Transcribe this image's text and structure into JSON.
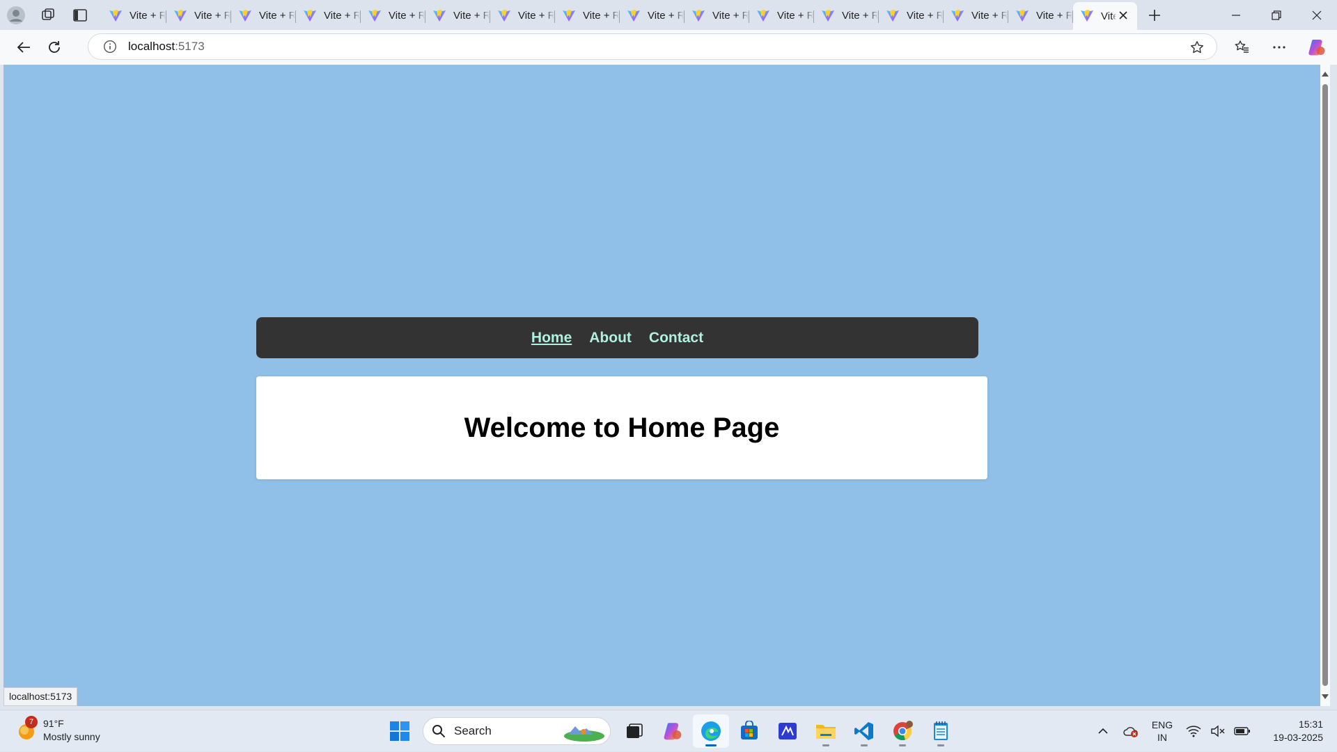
{
  "browser": {
    "tabs": [
      {
        "title": "Vite + React"
      },
      {
        "title": "Vite + React"
      },
      {
        "title": "Vite + React"
      },
      {
        "title": "Vite + React"
      },
      {
        "title": "Vite + React"
      },
      {
        "title": "Vite + React"
      },
      {
        "title": "Vite + React"
      },
      {
        "title": "Vite + React"
      },
      {
        "title": "Vite + React"
      },
      {
        "title": "Vite + React"
      },
      {
        "title": "Vite + React"
      },
      {
        "title": "Vite + React"
      },
      {
        "title": "Vite + React"
      },
      {
        "title": "Vite + React"
      },
      {
        "title": "Vite + React"
      }
    ],
    "active_tab": {
      "title": "Vite + React"
    },
    "address": {
      "host": "localhost",
      "port": ":5173"
    },
    "status_url": "localhost:5173"
  },
  "page": {
    "nav": [
      {
        "label": "Home",
        "current": true
      },
      {
        "label": "About",
        "current": false
      },
      {
        "label": "Contact",
        "current": false
      }
    ],
    "heading": "Welcome to Home Page",
    "colors": {
      "background": "#90bfe7",
      "nav_bg": "#333333",
      "nav_link": "#aff0df",
      "card_bg": "#ffffff"
    }
  },
  "taskbar": {
    "weather": {
      "badge": "7",
      "temp": "91°F",
      "condition": "Mostly sunny"
    },
    "search_placeholder": "Search",
    "apps": [
      "file-explorer-dark",
      "copilot",
      "edge",
      "store",
      "mail-alt",
      "file-explorer",
      "vscode",
      "chrome",
      "notepad"
    ],
    "tray": {
      "lang1": "ENG",
      "lang2": "IN",
      "time": "15:31",
      "date": "19-03-2025"
    }
  }
}
